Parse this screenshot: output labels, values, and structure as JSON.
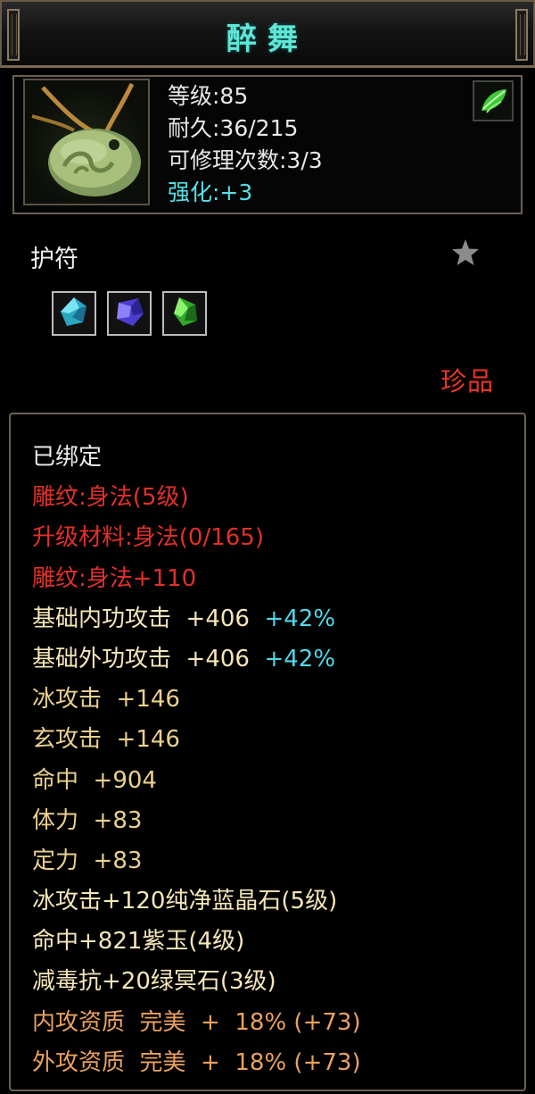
{
  "item": {
    "name": "醉舞",
    "stats": [
      {
        "label": "等级:85",
        "color": "#e8e8e8"
      },
      {
        "label": "耐久:36/215",
        "color": "#e8e8e8"
      },
      {
        "label": "可修理次数:3/3",
        "color": "#e8e8e8"
      },
      {
        "label": "强化:+3",
        "color": "#55e0e8"
      }
    ],
    "type": "护符",
    "rarity": "珍品",
    "icons": {
      "item": "jade-pendant-icon",
      "corner": "green-leaf-icon",
      "favorite": "star-icon"
    },
    "gems": [
      {
        "name": "blue-gem-icon",
        "color": "#3fd0e0"
      },
      {
        "name": "purple-gem-icon",
        "color": "#6a5cf0"
      },
      {
        "name": "green-gem-icon",
        "color": "#46d43a"
      }
    ]
  },
  "attributes": [
    [
      {
        "text": "已绑定",
        "color": "white"
      }
    ],
    [
      {
        "text": "雕纹:身法(5级)",
        "color": "red"
      }
    ],
    [
      {
        "text": "升级材料:身法(0/165)",
        "color": "red"
      }
    ],
    [
      {
        "text": "雕纹:身法+110",
        "color": "red"
      }
    ],
    [
      {
        "text": "基础内功攻击  +406  ",
        "color": "cream"
      },
      {
        "text": "+42%",
        "color": "cyan"
      }
    ],
    [
      {
        "text": "基础外功攻击  +406  ",
        "color": "cream"
      },
      {
        "text": "+42%",
        "color": "cyan"
      }
    ],
    [
      {
        "text": "冰攻击  +146",
        "color": "tan"
      }
    ],
    [
      {
        "text": "玄攻击  +146",
        "color": "tan"
      }
    ],
    [
      {
        "text": "命中  +904",
        "color": "tan"
      }
    ],
    [
      {
        "text": "体力  +83",
        "color": "tan"
      }
    ],
    [
      {
        "text": "定力  +83",
        "color": "tan"
      }
    ],
    [
      {
        "text": "冰攻击+120纯净蓝晶石(5级)",
        "color": "cream"
      }
    ],
    [
      {
        "text": "命中+821紫玉(4级)",
        "color": "cream"
      }
    ],
    [
      {
        "text": "减毒抗+20绿冥石(3级)",
        "color": "cream"
      }
    ],
    [
      {
        "text": "内攻资质  完美  +  18% (+73)",
        "color": "orange"
      }
    ],
    [
      {
        "text": "外攻资质  完美  +  18% (+73)",
        "color": "orange"
      }
    ]
  ]
}
